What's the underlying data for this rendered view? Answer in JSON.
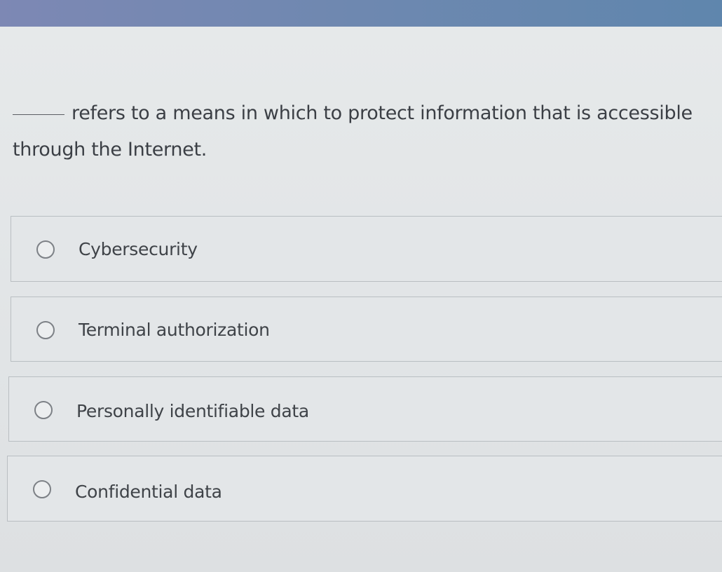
{
  "question": {
    "blank": "_____",
    "text": "refers to a means in which to protect information that is accessible through the Internet."
  },
  "options": [
    {
      "label": "Cybersecurity",
      "selected": false
    },
    {
      "label": "Terminal authorization",
      "selected": false
    },
    {
      "label": "Personally identifiable data",
      "selected": false
    },
    {
      "label": "Confidential data",
      "selected": false
    }
  ],
  "colors": {
    "header_bar": "#6e88b0",
    "background": "#e2e5e7",
    "option_border": "#b9bec2",
    "text": "#3d4146"
  }
}
